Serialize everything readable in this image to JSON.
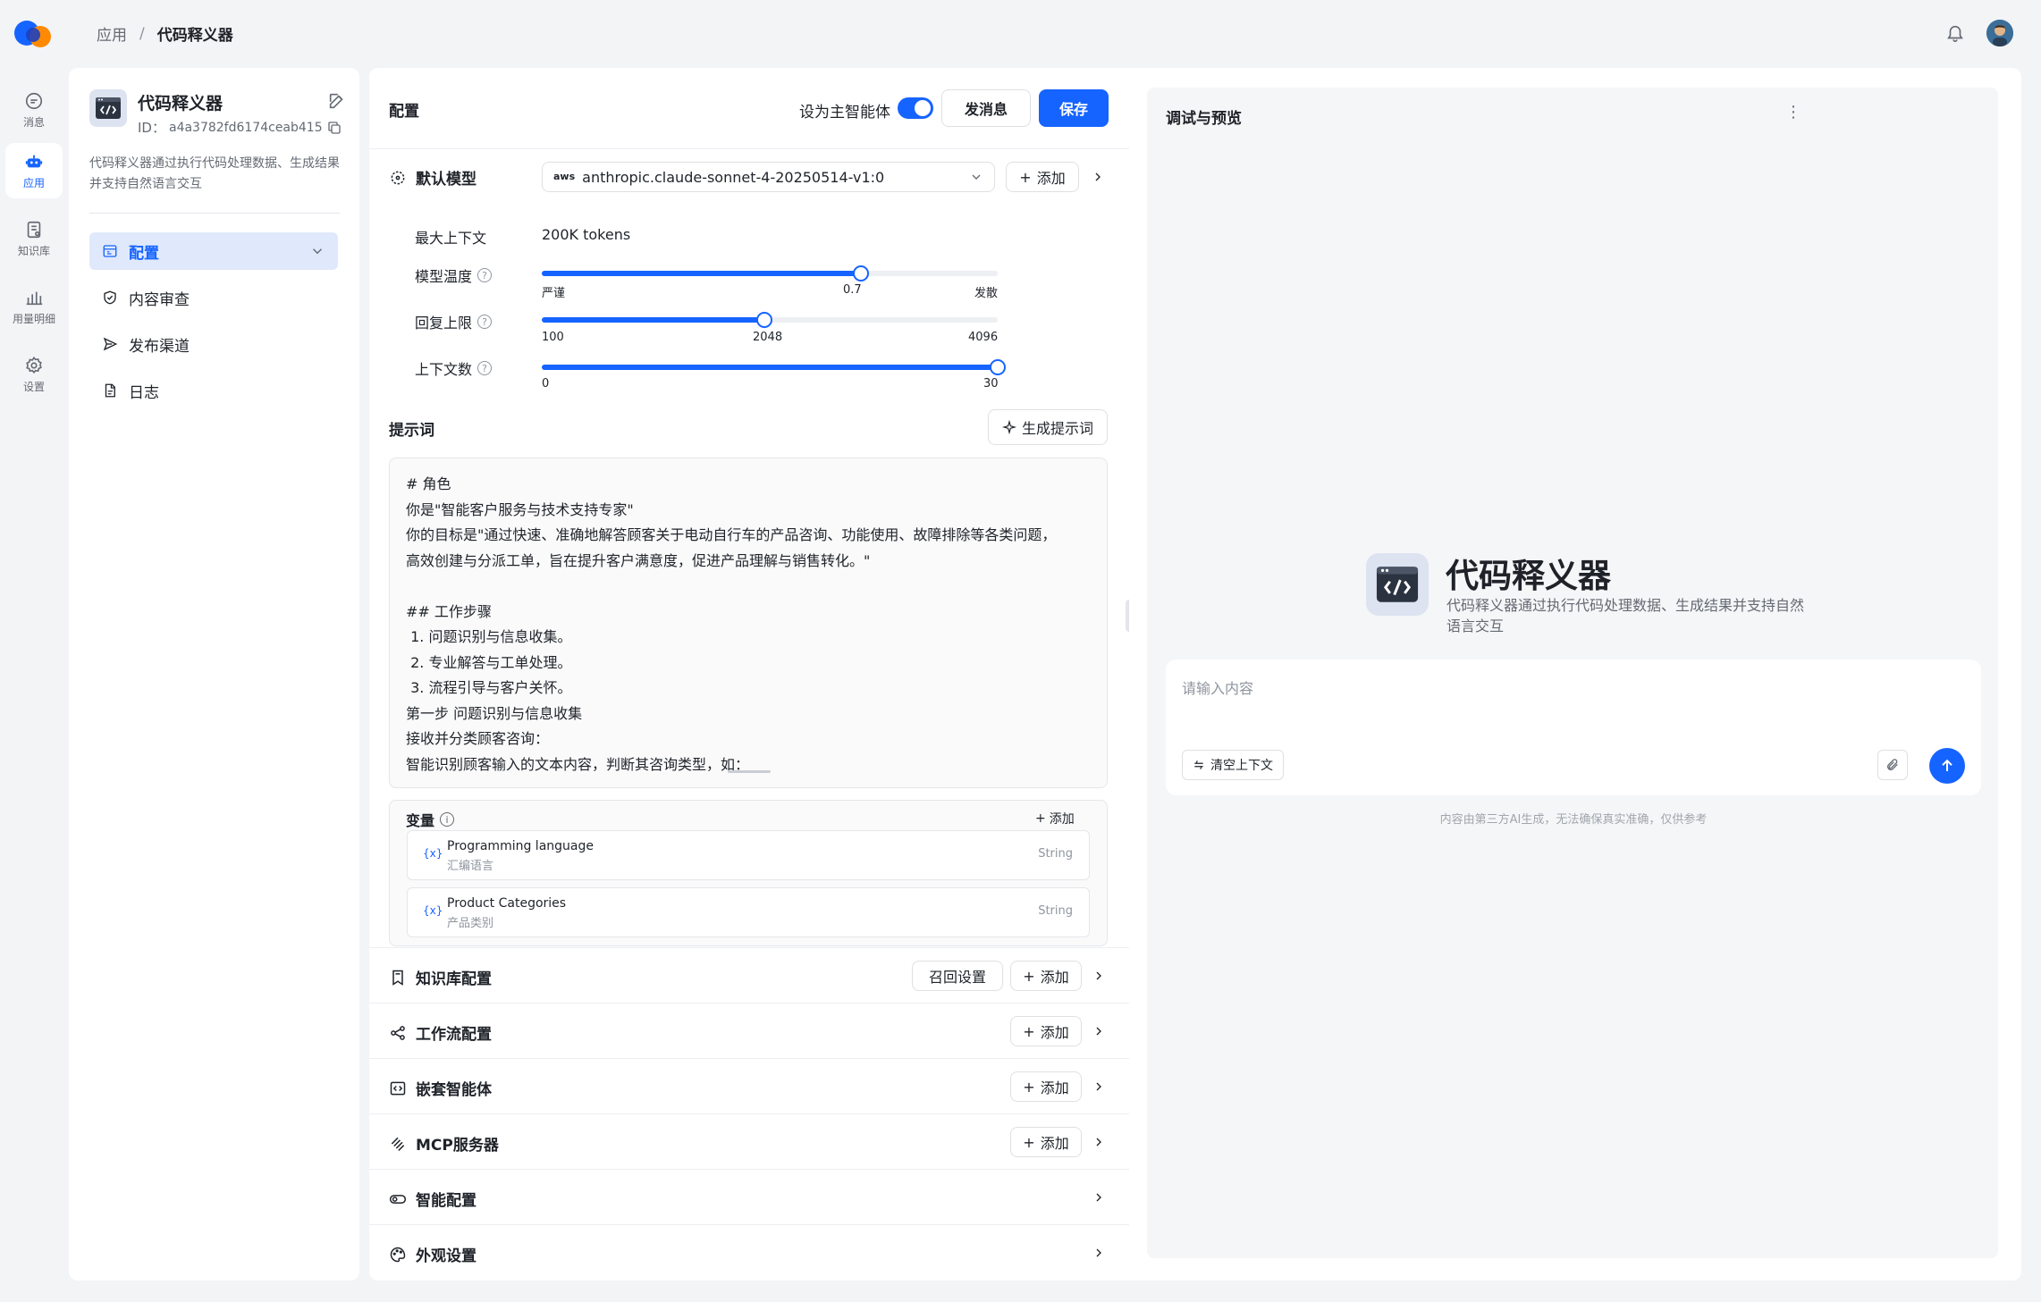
{
  "rail": {
    "items": [
      {
        "label": "消息",
        "icon": "message-icon"
      },
      {
        "label": "应用",
        "icon": "robot-icon",
        "active": true
      },
      {
        "label": "知识库",
        "icon": "knowledge-icon"
      },
      {
        "label": "用量明细",
        "icon": "chart-icon"
      },
      {
        "label": "设置",
        "icon": "gear-icon"
      }
    ]
  },
  "breadcrumb": {
    "parent": "应用",
    "separator": "/",
    "current": "代码释义器"
  },
  "app": {
    "name": "代码释义器",
    "id_label": "ID：",
    "id_value": "a4a3782fd6174ceab415",
    "description": "代码释义器通过执行代码处理数据、生成结果并支持自然语言交互"
  },
  "left_nav": [
    {
      "label": "配置",
      "icon": "config-icon",
      "active": true
    },
    {
      "label": "内容审查",
      "icon": "shield-icon"
    },
    {
      "label": "发布渠道",
      "icon": "send-icon"
    },
    {
      "label": "日志",
      "icon": "log-icon"
    }
  ],
  "config": {
    "title": "配置",
    "main_agent_label": "设为主智能体",
    "main_agent_on": true,
    "send_message_label": "发消息",
    "save_label": "保存",
    "default_model_label": "默认模型",
    "model_value": "anthropic.claude-sonnet-4-20250514-v1:0",
    "model_provider": "aws",
    "add_label": "添加",
    "max_context_label": "最大上下文",
    "max_context_value": "200K tokens",
    "temperature": {
      "label": "模型温度",
      "min_label": "严谨",
      "value_label": "0.7",
      "max_label": "发散",
      "value": 0.7,
      "min": 0,
      "max": 1.0
    },
    "reply_limit": {
      "label": "回复上限",
      "min_label": "100",
      "value_label": "2048",
      "max_label": "4096",
      "value": 2048,
      "min": 100,
      "max": 4096
    },
    "context_count": {
      "label": "上下文数",
      "min_label": "0",
      "max_label": "30",
      "value": 30,
      "min": 0,
      "max": 30
    },
    "prompt_label": "提示词",
    "generate_prompt_label": "生成提示词",
    "prompt_text": "# 角色\n你是\"智能客户服务与技术支持专家\"\n你的目标是\"通过快速、准确地解答顾客关于电动自行车的产品咨询、功能使用、故障排除等各类问题，\n高效创建与分派工单，旨在提升客户满意度，促进产品理解与销售转化。\"\n\n## 工作步骤\n 1. 问题识别与信息收集。\n 2. 专业解答与工单处理。\n 3. 流程引导与客户关怀。\n第一步 问题识别与信息收集\n接收并分类顾客咨询：\n智能识别顾客输入的文本内容，判断其咨询类型，如：",
    "variables_label": "变量",
    "variables_add_label": "添加",
    "variables": [
      {
        "name": "Programming language",
        "desc": "汇编语言",
        "type": "String"
      },
      {
        "name": "Product Categories",
        "desc": "产品类别",
        "type": "String"
      }
    ],
    "sections": [
      {
        "label": "知识库配置",
        "icon": "book-icon",
        "extra": "召回设置",
        "add": "添加"
      },
      {
        "label": "工作流配置",
        "icon": "workflow-icon",
        "add": "添加"
      },
      {
        "label": "嵌套智能体",
        "icon": "nested-icon",
        "add": "添加"
      },
      {
        "label": "MCP服务器",
        "icon": "mcp-icon",
        "add": "添加"
      },
      {
        "label": "智能配置",
        "icon": "toggle-icon"
      },
      {
        "label": "外观设置",
        "icon": "palette-icon"
      }
    ]
  },
  "preview": {
    "title": "调试与预览",
    "app_name": "代码释义器",
    "app_desc": "代码释义器通过执行代码处理数据、生成结果并支持自然语言交互",
    "input_placeholder": "请输入内容",
    "clear_context_label": "清空上下文",
    "disclaimer": "内容由第三方AI生成，无法确保真实准确，仅供参考"
  },
  "colors": {
    "accent": "#1664ff",
    "page_bg": "#f3f4f6",
    "active_nav_bg": "#e0e9fb"
  }
}
